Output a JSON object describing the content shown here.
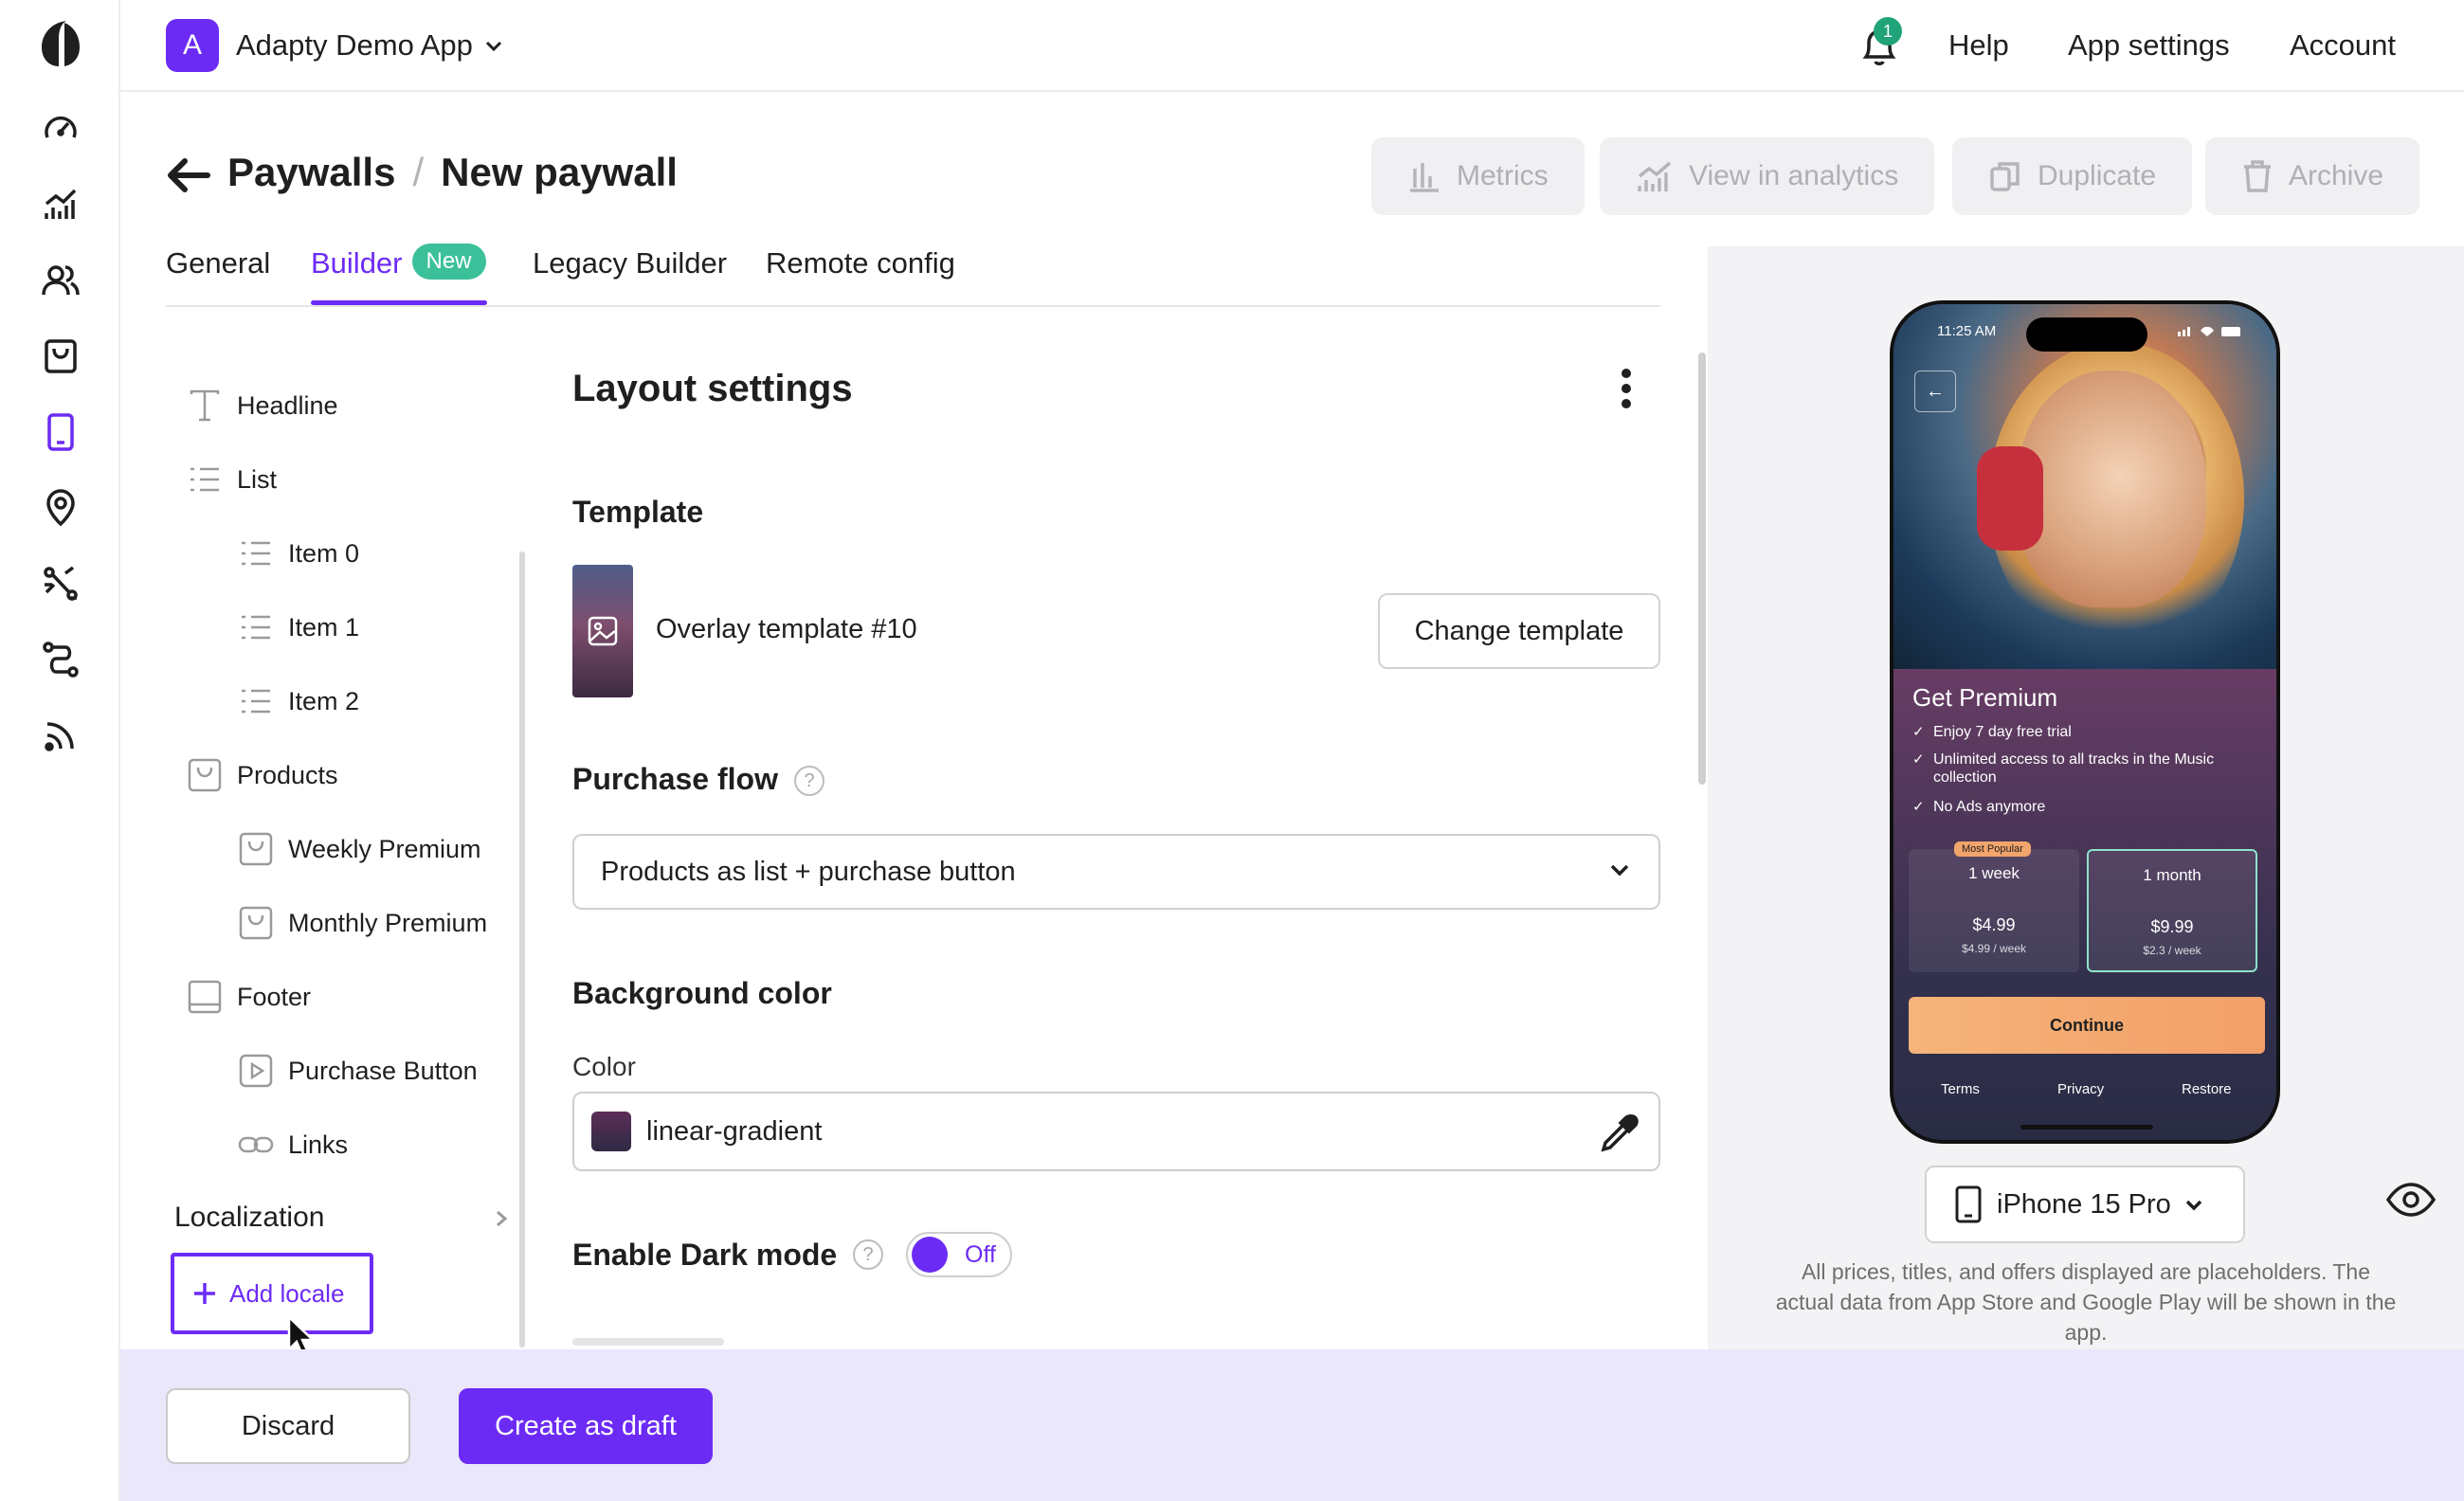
{
  "colors": {
    "accent": "#6c2bf5",
    "new_badge": "#3bc09a",
    "notification_badge": "#21a37a",
    "footer_bg": "#ebe7fb"
  },
  "rail": {
    "items": [
      {
        "icon": "dashboard-icon"
      },
      {
        "icon": "analytics-icon"
      },
      {
        "icon": "profiles-icon"
      },
      {
        "icon": "products-icon"
      },
      {
        "icon": "paywalls-icon",
        "active": true
      },
      {
        "icon": "placements-icon"
      },
      {
        "icon": "ab-tests-icon"
      },
      {
        "icon": "flows-icon"
      },
      {
        "icon": "integrations-icon"
      }
    ]
  },
  "topbar": {
    "app_initial": "A",
    "app_name": "Adapty Demo App",
    "notifications_count": "1",
    "help": "Help",
    "app_settings": "App settings",
    "account": "Account"
  },
  "header": {
    "breadcrumb_parent": "Paywalls",
    "breadcrumb_sep": "/",
    "breadcrumb_current": "New paywall",
    "actions": {
      "metrics": "Metrics",
      "analytics": "View in analytics",
      "duplicate": "Duplicate",
      "archive": "Archive"
    }
  },
  "tabs": {
    "general": "General",
    "builder": "Builder",
    "builder_badge": "New",
    "legacy": "Legacy Builder",
    "remote": "Remote config",
    "active": "Builder"
  },
  "tree": {
    "headline": "Headline",
    "list": "List",
    "item0": "Item 0",
    "item1": "Item 1",
    "item2": "Item 2",
    "products": "Products",
    "weekly": "Weekly Premium",
    "monthly": "Monthly Premium",
    "footer": "Footer",
    "purchase_button": "Purchase Button",
    "links": "Links",
    "localization": "Localization",
    "add_locale": "Add locale"
  },
  "settings": {
    "title": "Layout settings",
    "template_label": "Template",
    "template_name": "Overlay template #10",
    "change_template": "Change template",
    "purchase_flow_label": "Purchase flow",
    "purchase_flow_value": "Products as list + purchase button",
    "bg_label": "Background color",
    "color_label": "Color",
    "color_value": "linear-gradient",
    "dark_mode_label": "Enable Dark mode",
    "dark_mode_state": "Off"
  },
  "preview": {
    "status_time": "11:25 AM",
    "paywall_title": "Get Premium",
    "features": [
      "Enjoy 7 day free trial",
      "Unlimited access to all tracks in the Music collection",
      "No Ads anymore"
    ],
    "plans": [
      {
        "badge": "Most Popular",
        "name": "1 week",
        "price": "$4.99",
        "per": "$4.99 / week"
      },
      {
        "name": "1 month",
        "price": "$9.99",
        "per": "$2.3 / week",
        "selected": true
      }
    ],
    "continue": "Continue",
    "links": {
      "terms": "Terms",
      "privacy": "Privacy",
      "restore": "Restore"
    },
    "device": "iPhone 15 Pro",
    "disclaimer": "All prices, titles, and offers displayed are placeholders. The actual data from App Store and Google Play will be shown in the app."
  },
  "footer": {
    "discard": "Discard",
    "create_draft": "Create as draft"
  }
}
